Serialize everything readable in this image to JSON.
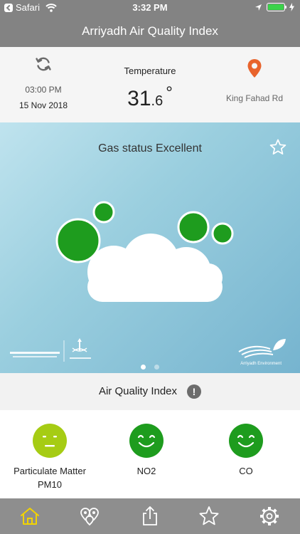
{
  "status_bar": {
    "back_app": "Safari",
    "time": "3:32 PM"
  },
  "header": {
    "title": "Arriyadh Air Quality Index"
  },
  "info": {
    "time": "03:00 PM",
    "date": "15 Nov 2018",
    "temperature_label": "Temperature",
    "temperature_int": "31",
    "temperature_dec": ".6",
    "temperature_unit": "°",
    "location": "King Fahad Rd"
  },
  "banner": {
    "gas_status": "Gas status Excellent",
    "page_index": 1,
    "page_count": 2,
    "right_logo_text": "Arriyadh Environment"
  },
  "aqi": {
    "title": "Air Quality Index",
    "info_glyph": "!"
  },
  "pollutants": [
    {
      "name_line1": "Particulate Matter",
      "name_line2": "PM10",
      "status": "moderate",
      "color": "#a6cc14"
    },
    {
      "name_line1": "NO2",
      "name_line2": "",
      "status": "good",
      "color": "#1e9c1e"
    },
    {
      "name_line1": "CO",
      "name_line2": "",
      "status": "good",
      "color": "#1e9c1e"
    }
  ],
  "tabs": [
    {
      "icon": "home-icon",
      "active": true
    },
    {
      "icon": "map-pins-icon",
      "active": false
    },
    {
      "icon": "share-icon",
      "active": false
    },
    {
      "icon": "star-icon",
      "active": false
    },
    {
      "icon": "gear-icon",
      "active": false
    }
  ],
  "colors": {
    "bar_gray": "#838383",
    "accent_orange": "#e8632c",
    "good_green": "#1e9c1e",
    "moderate_green": "#a6cc14",
    "tab_active": "#f2d300"
  }
}
